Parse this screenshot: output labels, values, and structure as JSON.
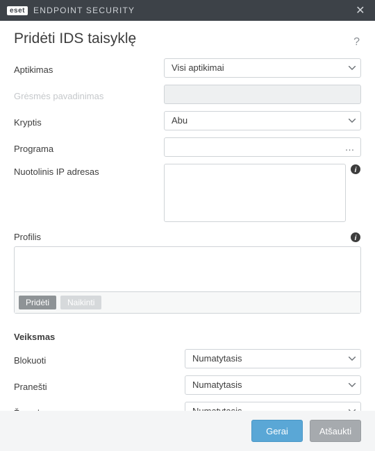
{
  "titlebar": {
    "logo_text": "eset",
    "product_name": "ENDPOINT SECURITY"
  },
  "header": {
    "title": "Pridėti IDS taisyklę"
  },
  "labels": {
    "detection": "Aptikimas",
    "threat_name": "Grėsmės pavadinimas",
    "direction": "Kryptis",
    "application": "Programa",
    "remote_ip": "Nuotolinis IP adresas",
    "profile": "Profilis",
    "action_section": "Veiksmas",
    "block": "Blokuoti",
    "notify": "Pranešti",
    "log": "Žurnalas"
  },
  "fields": {
    "detection": {
      "value": "Visi aptikimai"
    },
    "threat_name": {
      "value": ""
    },
    "direction": {
      "value": "Abu"
    },
    "application": {
      "value": ""
    },
    "remote_ip": {
      "value": ""
    },
    "block": {
      "value": "Numatytasis"
    },
    "notify": {
      "value": "Numatytasis"
    },
    "log": {
      "value": "Numatytasis"
    }
  },
  "buttons": {
    "add": "Pridėti",
    "delete": "Naikinti",
    "ok": "Gerai",
    "cancel": "Atšaukti"
  }
}
